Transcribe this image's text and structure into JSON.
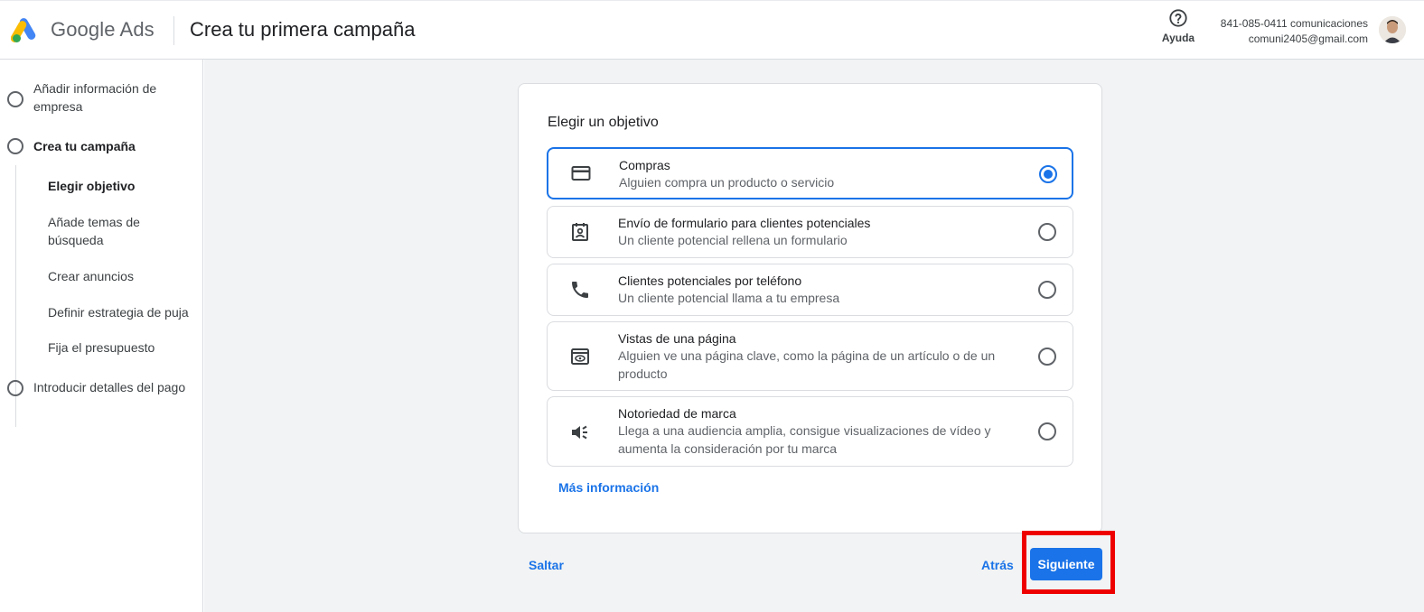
{
  "header": {
    "brand": "Google Ads",
    "page_title": "Crea tu primera campaña",
    "help_label": "Ayuda",
    "account_line1": "841-085-0411 comunicaciones",
    "account_line2": "comuni2405@gmail.com"
  },
  "sidebar": {
    "steps": [
      {
        "label_line1": "Añadir información de",
        "label_line2": "empresa"
      },
      {
        "label": "Crea tu campaña"
      },
      {
        "label": "Introducir detalles del pago"
      }
    ],
    "substeps": [
      {
        "label": "Elegir objetivo"
      },
      {
        "label_line1": "Añade temas de",
        "label_line2": "búsqueda"
      },
      {
        "label": "Crear anuncios"
      },
      {
        "label": "Definir estrategia de puja"
      },
      {
        "label": "Fija el presupuesto"
      }
    ]
  },
  "card": {
    "title": "Elegir un objetivo",
    "options": [
      {
        "title": "Compras",
        "desc": "Alguien compra un producto o servicio",
        "icon": "credit-card-icon",
        "selected": true
      },
      {
        "title": "Envío de formulario para clientes potenciales",
        "desc": "Un cliente potencial rellena un formulario",
        "icon": "contact-form-icon",
        "selected": false
      },
      {
        "title": "Clientes potenciales por teléfono",
        "desc": "Un cliente potencial llama a tu empresa",
        "icon": "phone-icon",
        "selected": false
      },
      {
        "title": "Vistas de una página",
        "desc_line1": "Alguien ve una página clave, como la página de un artículo o de un",
        "desc_line2": "producto",
        "icon": "page-view-icon",
        "selected": false
      },
      {
        "title": "Notoriedad de marca",
        "desc_line1": "Llega a una audiencia amplia, consigue visualizaciones de vídeo y",
        "desc_line2": "aumenta la consideración por tu marca",
        "icon": "megaphone-icon",
        "selected": false
      }
    ],
    "more_info": "Más información"
  },
  "footer": {
    "skip": "Saltar",
    "back": "Atrás",
    "next": "Siguiente"
  },
  "colors": {
    "accent": "#1a73e8",
    "highlight": "#ee0000",
    "background": "#f1f3f4"
  }
}
